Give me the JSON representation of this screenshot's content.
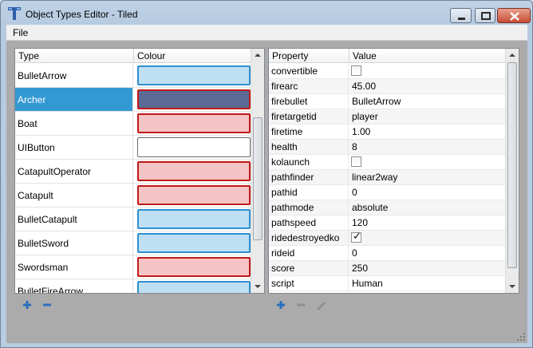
{
  "window": {
    "title": "Object Types Editor - Tiled",
    "icon": "tiled-app-icon"
  },
  "menubar": {
    "file_label": "File"
  },
  "types_table": {
    "headers": {
      "type": "Type",
      "colour": "Colour"
    },
    "rows": [
      {
        "name": "BulletArrow",
        "color": "#bfe0f2",
        "border": "sel-blue",
        "selected": false
      },
      {
        "name": "Archer",
        "color": "#5b6b96",
        "border": "sel-red",
        "selected": true
      },
      {
        "name": "Boat",
        "color": "#f5c4c6",
        "border": "sel-red",
        "selected": false
      },
      {
        "name": "UIButton",
        "color": "#ffffff",
        "border": "plain",
        "selected": false
      },
      {
        "name": "CatapultOperator",
        "color": "#f5c4c6",
        "border": "sel-red",
        "selected": false
      },
      {
        "name": "Catapult",
        "color": "#f5c4c6",
        "border": "sel-red",
        "selected": false
      },
      {
        "name": "BulletCatapult",
        "color": "#bfe0f2",
        "border": "sel-blue",
        "selected": false
      },
      {
        "name": "BulletSword",
        "color": "#bfe0f2",
        "border": "sel-blue",
        "selected": false
      },
      {
        "name": "Swordsman",
        "color": "#f5c4c6",
        "border": "sel-red",
        "selected": false
      },
      {
        "name": "BulletFireArrow",
        "color": "#bfe0f2",
        "border": "sel-blue",
        "selected": false
      }
    ],
    "add_icon": "plus-icon",
    "remove_icon": "minus-icon"
  },
  "properties_table": {
    "headers": {
      "property": "Property",
      "value": "Value"
    },
    "rows": [
      {
        "name": "convertible",
        "value": "",
        "checkbox": true,
        "checked": false
      },
      {
        "name": "firearc",
        "value": "45.00"
      },
      {
        "name": "firebullet",
        "value": "BulletArrow"
      },
      {
        "name": "firetargetid",
        "value": "player"
      },
      {
        "name": "firetime",
        "value": "1.00"
      },
      {
        "name": "health",
        "value": "8"
      },
      {
        "name": "kolaunch",
        "value": "",
        "checkbox": true,
        "checked": false
      },
      {
        "name": "pathfinder",
        "value": "linear2way"
      },
      {
        "name": "pathid",
        "value": "0"
      },
      {
        "name": "pathmode",
        "value": "absolute"
      },
      {
        "name": "pathspeed",
        "value": "120"
      },
      {
        "name": "ridedestroyedko",
        "value": "",
        "checkbox": true,
        "checked": true
      },
      {
        "name": "rideid",
        "value": "0"
      },
      {
        "name": "score",
        "value": "250"
      },
      {
        "name": "script",
        "value": "Human"
      }
    ],
    "add_icon": "plus-icon",
    "remove_icon": "minus-icon",
    "rename_icon": "pencil-icon"
  },
  "colors": {
    "selection": "#3399d3",
    "accent_blue": "#2e8fd1",
    "accent_red": "#c01919"
  }
}
